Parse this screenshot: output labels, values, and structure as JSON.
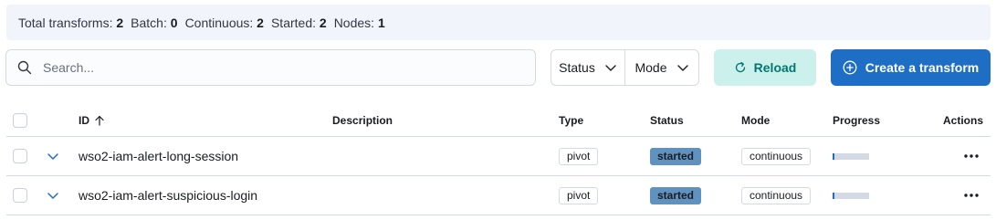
{
  "stats": [
    {
      "label": "Total transforms:",
      "value": "2"
    },
    {
      "label": "Batch:",
      "value": "0"
    },
    {
      "label": "Continuous:",
      "value": "2"
    },
    {
      "label": "Started:",
      "value": "2"
    },
    {
      "label": "Nodes:",
      "value": "1"
    }
  ],
  "search": {
    "placeholder": "Search..."
  },
  "filters": {
    "status_label": "Status",
    "mode_label": "Mode"
  },
  "toolbar": {
    "reload_label": "Reload",
    "create_label": "Create a transform"
  },
  "colors": {
    "accent": "#1e6ec6",
    "reload_bg": "#ccf0ec",
    "reload_text": "#007871",
    "started_badge": "#6092c0"
  },
  "table": {
    "headers": {
      "id": "ID",
      "description": "Description",
      "type": "Type",
      "status": "Status",
      "mode": "Mode",
      "progress": "Progress",
      "actions": "Actions"
    },
    "sort": {
      "column": "id",
      "direction": "ascending"
    },
    "rows": [
      {
        "id": "wso2-iam-alert-long-session",
        "description": "",
        "type": "pivot",
        "status": "started",
        "mode": "continuous",
        "progress": 0.05
      },
      {
        "id": "wso2-iam-alert-suspicious-login",
        "description": "",
        "type": "pivot",
        "status": "started",
        "mode": "continuous",
        "progress": 0.05
      }
    ]
  },
  "icons": {
    "search": "search-icon",
    "chevron": "chevron-down-icon",
    "reload": "refresh-icon",
    "create": "plus-in-circle-icon",
    "sort": "arrow-up-icon",
    "expand": "chevron-down-icon",
    "actions": "more-horizontal-icon"
  }
}
